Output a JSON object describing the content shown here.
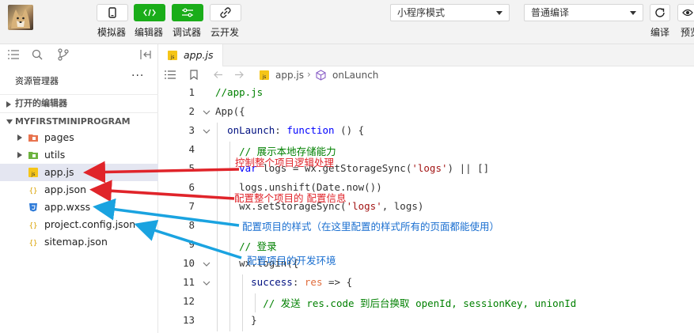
{
  "toolbar": {
    "simulator_label": "模拟器",
    "editor_label": "编辑器",
    "debugger_label": "调试器",
    "cloud_label": "云开发",
    "mode_select": "小程序模式",
    "compile_select": "普通编译",
    "compile_label": "编译",
    "preview_label": "预览"
  },
  "explorer": {
    "title": "资源管理器",
    "more": "···",
    "open_editors": "打开的编辑器",
    "project": "MYFIRSTMINIPROGRAM",
    "items": [
      {
        "label": "pages",
        "type": "folder"
      },
      {
        "label": "utils",
        "type": "folder"
      },
      {
        "label": "app.js",
        "type": "js"
      },
      {
        "label": "app.json",
        "type": "json"
      },
      {
        "label": "app.wxss",
        "type": "wxss"
      },
      {
        "label": "project.config.json",
        "type": "json"
      },
      {
        "label": "sitemap.json",
        "type": "json"
      }
    ]
  },
  "editor": {
    "tab": "app.js",
    "breadcrumb": {
      "file": "app.js",
      "symbol": "onLaunch"
    },
    "line_numbers": [
      "1",
      "2",
      "3",
      "4",
      "5",
      "6",
      "7",
      "8",
      "9",
      "10",
      "11",
      "12",
      "13"
    ],
    "lines": [
      "//app.js",
      "App({",
      "  onLaunch: function () {",
      "    // 展示本地存储能力",
      "    var logs = wx.getStorageSync('logs') || []",
      "    logs.unshift(Date.now())",
      "    wx.setStorageSync('logs', logs)",
      "",
      "    // 登录",
      "    wx.login({",
      "      success: res => {",
      "        // 发送 res.code 到后台换取 openId, sessionKey, unionId",
      "      }"
    ]
  },
  "annotations": [
    {
      "text": "控制整个项目逻辑处理",
      "color": "#e0242a"
    },
    {
      "text": "配置整个项目的 配置信息",
      "color": "#e0242a"
    },
    {
      "text": "配置项目的样式（在这里配置的样式所有的页面都能使用）",
      "color": "#1a6fd0"
    },
    {
      "text": "配置项目的开发环境",
      "color": "#1a6fd0"
    }
  ],
  "colors": {
    "accent_green": "#1aad19",
    "keyword": "#0000ff",
    "comment": "#008000",
    "string": "#a31515",
    "selection": "#e4e6f1"
  }
}
